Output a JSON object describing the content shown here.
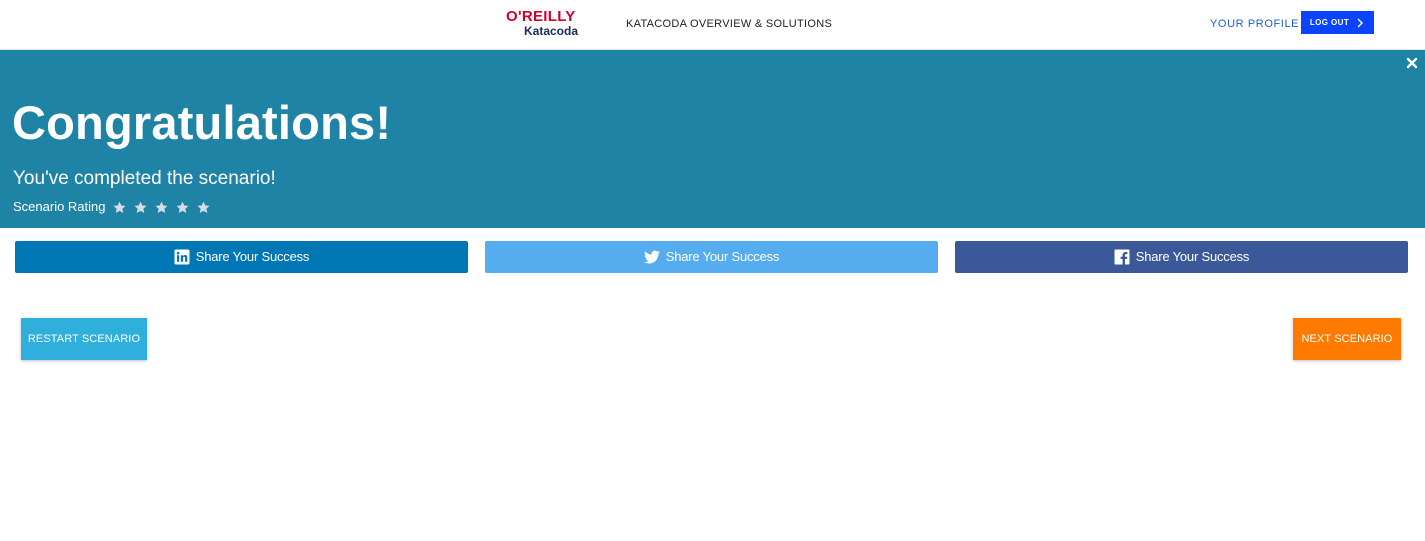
{
  "header": {
    "logo": {
      "brand": "O'REILLY",
      "product": "Katacoda"
    },
    "nav_overview": "KATACODA OVERVIEW & SOLUTIONS",
    "nav_profile": "YOUR PROFILE",
    "logout_label": "LOG OUT",
    "logout_icon": "chevron-right-icon"
  },
  "banner": {
    "title": "Congratulations!",
    "subtitle": "You've completed the scenario!",
    "rating_label": "Scenario Rating",
    "rating_max": 5,
    "rating_value": 0,
    "close_icon": "close-icon",
    "background_color": "#1e83a4"
  },
  "share": [
    {
      "network": "linkedin",
      "label": "Share Your Success",
      "icon": "linkedin-icon",
      "color": "#0077b5"
    },
    {
      "network": "twitter",
      "label": "Share Your Success",
      "icon": "twitter-icon",
      "color": "#55acee"
    },
    {
      "network": "facebook",
      "label": "Share Your Success",
      "icon": "facebook-icon",
      "color": "#3b5998"
    }
  ],
  "actions": {
    "restart_label": "RESTART SCENARIO",
    "restart_color": "#2fb0dc",
    "next_label": "NEXT SCENARIO",
    "next_color": "#ff7a00"
  }
}
